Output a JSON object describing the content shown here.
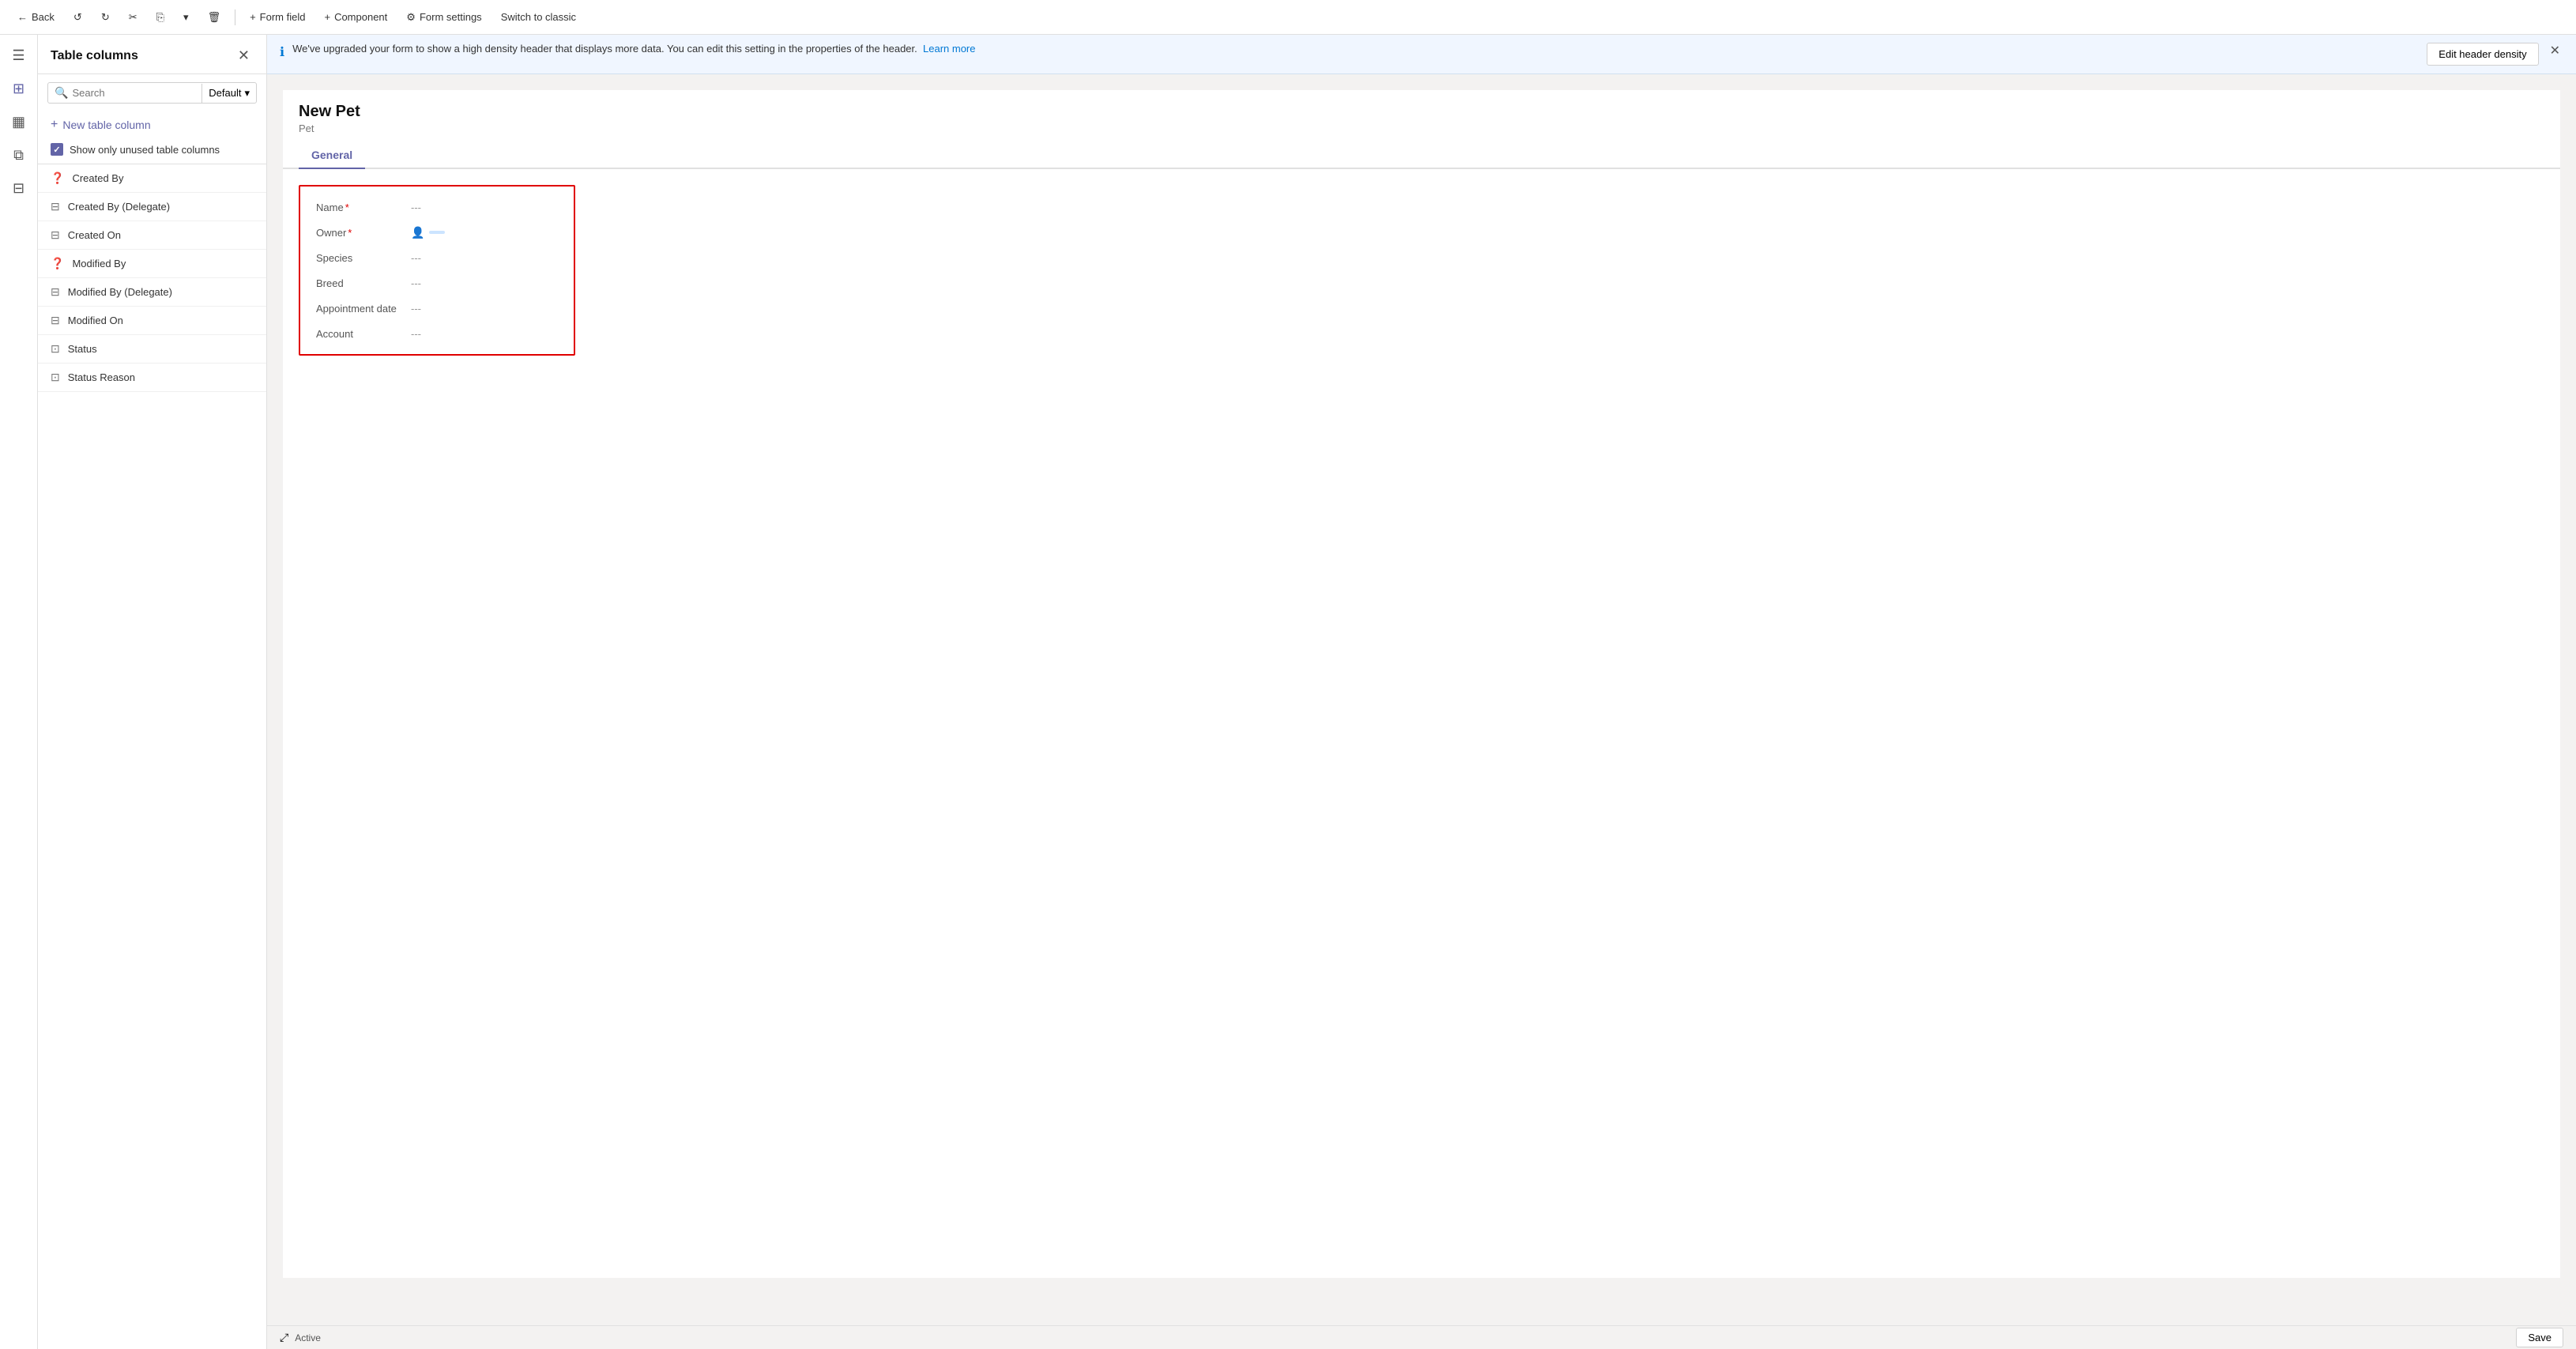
{
  "toolbar": {
    "back_label": "Back",
    "form_field_label": "Form field",
    "component_label": "Component",
    "form_settings_label": "Form settings",
    "switch_to_classic_label": "Switch to classic"
  },
  "sidebar_icons": [
    {
      "name": "hamburger-icon",
      "symbol": "☰"
    },
    {
      "name": "layout-icon",
      "symbol": "⊞"
    },
    {
      "name": "view-icon",
      "symbol": "▦"
    },
    {
      "name": "layers-icon",
      "symbol": "⧉"
    },
    {
      "name": "data-icon",
      "symbol": "⊟"
    }
  ],
  "columns_panel": {
    "title": "Table columns",
    "search_placeholder": "Search",
    "dropdown_label": "Default",
    "new_column_label": "New table column",
    "show_unused_label": "Show only unused table columns",
    "columns": [
      {
        "name": "Created By",
        "icon": "❓",
        "type": "lookup"
      },
      {
        "name": "Created By (Delegate)",
        "icon": "⊟",
        "type": "lookup"
      },
      {
        "name": "Created On",
        "icon": "⊟",
        "type": "datetime"
      },
      {
        "name": "Modified By",
        "icon": "❓",
        "type": "lookup"
      },
      {
        "name": "Modified By (Delegate)",
        "icon": "⊟",
        "type": "lookup"
      },
      {
        "name": "Modified On",
        "icon": "⊟",
        "type": "datetime"
      },
      {
        "name": "Status",
        "icon": "⊡",
        "type": "status"
      },
      {
        "name": "Status Reason",
        "icon": "⊡",
        "type": "status"
      }
    ]
  },
  "banner": {
    "text": "We've upgraded your form to show a high density header that displays more data. You can edit this setting in the properties of the header.",
    "link_text": "Learn more",
    "edit_header_label": "Edit header density"
  },
  "form": {
    "title": "New Pet",
    "subtitle": "Pet",
    "tab_label": "General",
    "fields": [
      {
        "label": "Name",
        "required": true,
        "value": "---"
      },
      {
        "label": "Owner",
        "required": true,
        "value": "owner",
        "type": "lookup"
      },
      {
        "label": "Species",
        "required": false,
        "value": "---"
      },
      {
        "label": "Breed",
        "required": false,
        "value": "---"
      },
      {
        "label": "Appointment date",
        "required": false,
        "value": "---"
      },
      {
        "label": "Account",
        "required": false,
        "value": "---"
      }
    ]
  },
  "status_bar": {
    "expand_icon": "⤢",
    "status_text": "Active",
    "save_label": "Save"
  }
}
